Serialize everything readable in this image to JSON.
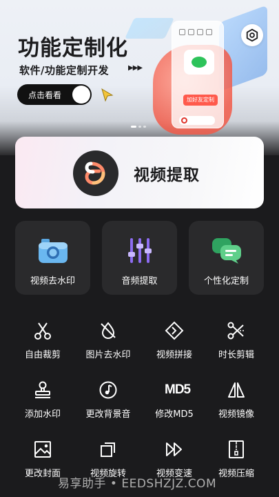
{
  "banner": {
    "title": "功能定制化",
    "subtitle": "软件/功能定制开发",
    "arrows": "▶▶▶",
    "cta_label": "点击看看",
    "phone_label": "加好友定制"
  },
  "extract_card": {
    "title": "视频提取"
  },
  "feature_tiles": [
    {
      "label": "视频去水印",
      "icon": "camera-icon"
    },
    {
      "label": "音频提取",
      "icon": "equalizer-icon"
    },
    {
      "label": "个性化定制",
      "icon": "chat-bubbles-icon"
    }
  ],
  "tools": [
    {
      "label": "自由裁剪",
      "icon": "scissors-icon"
    },
    {
      "label": "图片去水印",
      "icon": "no-watermark-icon"
    },
    {
      "label": "视频拼接",
      "icon": "join-icon"
    },
    {
      "label": "时长剪辑",
      "icon": "cut-icon"
    },
    {
      "label": "添加水印",
      "icon": "stamp-icon"
    },
    {
      "label": "更改背景音",
      "icon": "music-icon"
    },
    {
      "label": "修改MD5",
      "icon": "md5-icon",
      "glyph": "MD5"
    },
    {
      "label": "视频镜像",
      "icon": "mirror-icon"
    },
    {
      "label": "更改封面",
      "icon": "image-icon"
    },
    {
      "label": "视频旋转",
      "icon": "rotate-icon"
    },
    {
      "label": "视频变速",
      "icon": "fast-forward-icon"
    },
    {
      "label": "视频压缩",
      "icon": "zip-icon"
    }
  ],
  "watermark": "易享助手 • EEDSHZJZ.COM",
  "colors": {
    "background": "#1b1b1d",
    "tile": "#2a2a2c",
    "accent_red": "#f25a48",
    "accent_purple": "#7a5cf0"
  }
}
